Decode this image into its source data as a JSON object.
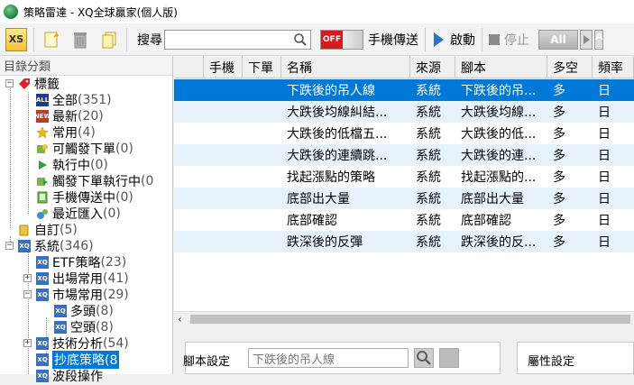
{
  "window": {
    "title": "策略雷達 - XQ全球贏家(個人版)"
  },
  "toolbar": {
    "xs_label": "XS",
    "search_label": "搜尋",
    "search_value": "",
    "toggle_label": "OFF",
    "mobile_send_label": "手機傳送",
    "start_label": "啟動",
    "stop_label": "停止",
    "all_label": "All",
    "trailing_label": "A"
  },
  "sidebar": {
    "header": "目錄分類",
    "items": [
      {
        "label": "標籤",
        "count": ""
      },
      {
        "label": "全部",
        "count": "(351)"
      },
      {
        "label": "最新",
        "count": "(20)"
      },
      {
        "label": "常用",
        "count": "(4)"
      },
      {
        "label": "可觸發下單",
        "count": "(0)"
      },
      {
        "label": "執行中",
        "count": "(0)"
      },
      {
        "label": "觸發下單執行中",
        "count": "(0"
      },
      {
        "label": "手機傳送中",
        "count": "(0)"
      },
      {
        "label": "最近匯入",
        "count": "(0)"
      },
      {
        "label": "自訂",
        "count": "(5)"
      },
      {
        "label": "系統",
        "count": "(346)"
      },
      {
        "label": "ETF策略",
        "count": "(23)"
      },
      {
        "label": "出場常用",
        "count": "(41)"
      },
      {
        "label": "市場常用",
        "count": "(29)"
      },
      {
        "label": "多頭",
        "count": "(8)"
      },
      {
        "label": "空頭",
        "count": "(8)"
      },
      {
        "label": "技術分析",
        "count": "(54)"
      },
      {
        "label": "抄底策略",
        "count": "(8"
      },
      {
        "label": "波段操作",
        "count": ""
      }
    ]
  },
  "grid": {
    "columns": [
      "",
      "手機",
      "下單",
      "名稱",
      "來源",
      "腳本",
      "多空",
      "頻率"
    ],
    "rows": [
      {
        "name": "下跌後的吊人線",
        "source": "系統",
        "script": "下跌後的吊...",
        "direction": "多",
        "freq": "日"
      },
      {
        "name": "大跌後均線糾結...",
        "source": "系統",
        "script": "大跌後均線...",
        "direction": "多",
        "freq": "日"
      },
      {
        "name": "大跌後的低檔五...",
        "source": "系統",
        "script": "大跌後的低...",
        "direction": "多",
        "freq": "日"
      },
      {
        "name": "大跌後的連續跳...",
        "source": "系統",
        "script": "大跌後的連...",
        "direction": "多",
        "freq": "日"
      },
      {
        "name": "找起漲點的策略",
        "source": "系統",
        "script": "找起漲點的...",
        "direction": "多",
        "freq": "日"
      },
      {
        "name": "底部出大量",
        "source": "系統",
        "script": "底部出大量",
        "direction": "多",
        "freq": "日"
      },
      {
        "name": "底部確認",
        "source": "系統",
        "script": "底部確認",
        "direction": "多",
        "freq": "日"
      },
      {
        "name": "跌深後的反彈",
        "source": "系統",
        "script": "跌深後的反...",
        "direction": "多",
        "freq": "日"
      }
    ]
  },
  "bottom": {
    "script_setting_label": "腳本設定",
    "script_value": "下跌後的吊人線",
    "property_setting_label": "屬性設定"
  },
  "colors": {
    "selection": "#0078d7",
    "alt_row": "#e6f2fc",
    "off_red": "#d71920"
  }
}
